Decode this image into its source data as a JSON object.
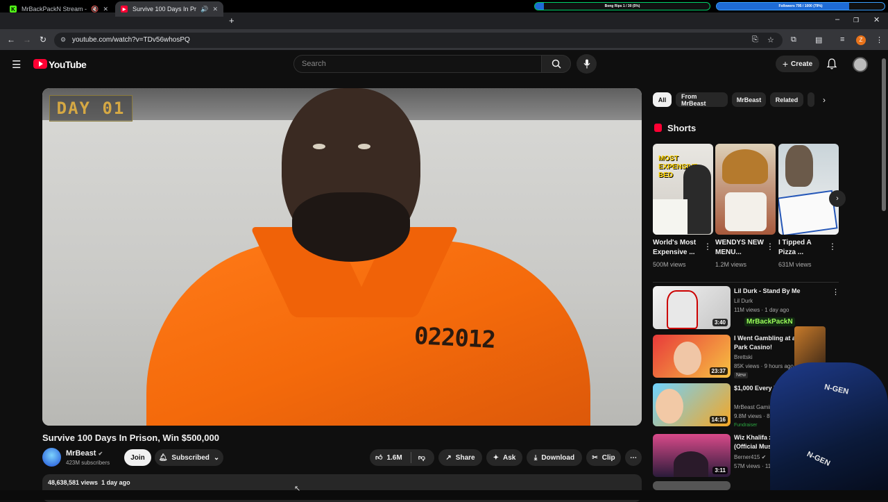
{
  "overlay": {
    "bar1": {
      "label": "Bong Rips 1 / 30 (5%)",
      "progress": 0.05,
      "color": "#1e6bd6"
    },
    "bar2": {
      "label": "Followers 795 / 1000 (79%)",
      "progress": 0.79,
      "color": "#1e6bd6"
    },
    "streamer_name": "MrBackPackN",
    "chair_logo": "N-GEN"
  },
  "browser": {
    "tabs": [
      {
        "title": "MrBackPackN Stream - Wa",
        "favicon": "K",
        "favicon_color": "#53fc18",
        "active": false
      },
      {
        "title": "Survive 100 Days In Prison,",
        "favicon": "▶",
        "favicon_color": "#ff0033",
        "active": true
      }
    ],
    "url": "youtube.com/watch?v=TDv56whosPQ",
    "profile_initial": "Z"
  },
  "header": {
    "logo_text": "YouTube",
    "search_placeholder": "Search",
    "create_label": "Create"
  },
  "video": {
    "day_overlay": "DAY 01",
    "inmate_number": "022012",
    "title": "Survive 100 Days In Prison, Win $500,000",
    "channel": "MrBeast",
    "subscribers": "423M subscribers",
    "join_label": "Join",
    "subscribed_label": "Subscribed",
    "likes": "1.6M",
    "share_label": "Share",
    "ask_label": "Ask",
    "download_label": "Download",
    "clip_label": "Clip",
    "views": "48,638,581 views",
    "age": "1 day ago"
  },
  "chips": [
    "All",
    "From MrBeast",
    "MrBeast",
    "Related"
  ],
  "shorts": {
    "heading": "Shorts",
    "items": [
      {
        "title": "World's Most Expensive ...",
        "views": "500M views",
        "thumb_text": "MOST EXPENSIVE BED"
      },
      {
        "title": "WENDYS NEW MENU...",
        "views": "1.2M views"
      },
      {
        "title": "I Tipped A Pizza ...",
        "views": "631M views"
      }
    ]
  },
  "recommended": [
    {
      "title": "Lil Durk - Stand By Me",
      "channel": "Lil Durk",
      "meta": "11M views · 1 day ago",
      "duration": "3:40"
    },
    {
      "title": "I Went Gambling at a Park Casino!",
      "channel": "Brettski",
      "meta": "85K views · 9 hours ago",
      "badge": "New",
      "duration": "23:37"
    },
    {
      "title": "$1,000 Every Minute You Survive",
      "channel": "MrBeast Gaming",
      "meta": "9.8M views · 8 days ago",
      "badge": "Fundraiser",
      "duration": "14:16"
    },
    {
      "title": "Wiz Khalifa x B (Official Mus",
      "channel": "Berner415",
      "meta": "57M views · 11 years",
      "duration": "3:11"
    }
  ]
}
